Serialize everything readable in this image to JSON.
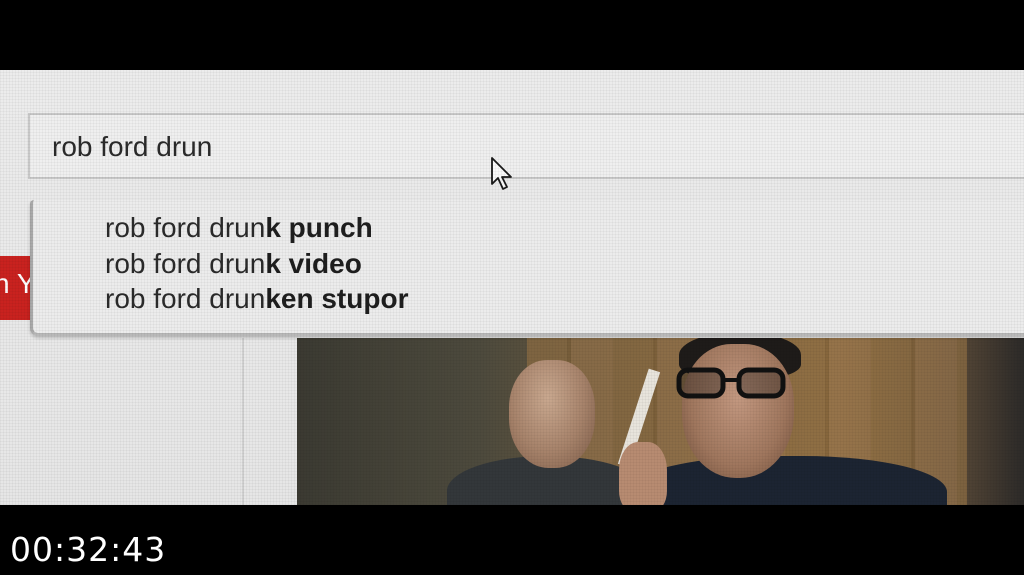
{
  "search": {
    "query": "rob ford drun"
  },
  "suggestions": [
    {
      "prefix": "rob ford drun",
      "completion": "k punch"
    },
    {
      "prefix": "rob ford drun",
      "completion": "k video"
    },
    {
      "prefix": "rob ford drun",
      "completion": "ken stupor"
    }
  ],
  "sidebar_fragment": "n Y",
  "timecode": "00:32:43",
  "colors": {
    "screen_background": "#ececec",
    "accent_red": "#c9221f",
    "text": "#2a2a2a"
  },
  "icons": {
    "cursor": "mouse-pointer-icon"
  }
}
